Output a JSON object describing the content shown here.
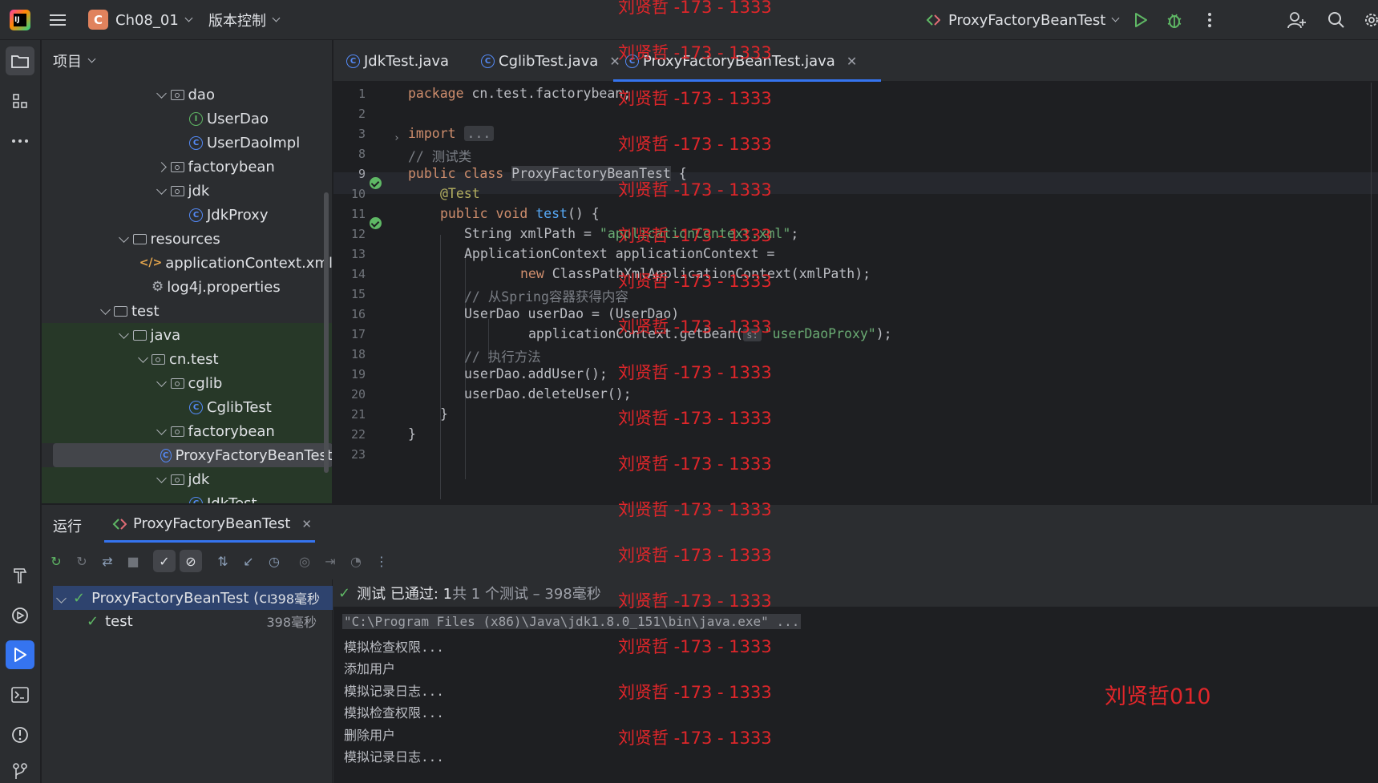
{
  "topbar": {
    "project_badge": "C",
    "project_name": "Ch08_01",
    "vcs_label": "版本控制",
    "run_config": "ProxyFactoryBeanTest"
  },
  "project_panel": {
    "header": "项目",
    "tree": [
      {
        "label": "dao",
        "kind": "package",
        "indent": 3,
        "chev": "open"
      },
      {
        "label": "UserDao",
        "kind": "interface",
        "indent": 4
      },
      {
        "label": "UserDaoImpl",
        "kind": "class",
        "indent": 4
      },
      {
        "label": "factorybean",
        "kind": "package",
        "indent": 3,
        "chev": "closed"
      },
      {
        "label": "jdk",
        "kind": "package",
        "indent": 3,
        "chev": "open"
      },
      {
        "label": "JdkProxy",
        "kind": "class",
        "indent": 4
      },
      {
        "label": "resources",
        "kind": "resfolder",
        "indent": 1,
        "chev": "open"
      },
      {
        "label": "applicationContext.xml",
        "kind": "xml",
        "indent": 2
      },
      {
        "label": "log4j.properties",
        "kind": "props",
        "indent": 2
      },
      {
        "label": "test",
        "kind": "folder",
        "indent": 0,
        "chev": "open"
      },
      {
        "label": "java",
        "kind": "srcfolder",
        "indent": 1,
        "chev": "open",
        "testbg": true
      },
      {
        "label": "cn.test",
        "kind": "package",
        "indent": 2,
        "chev": "open",
        "testbg": true
      },
      {
        "label": "cglib",
        "kind": "package",
        "indent": 3,
        "chev": "open",
        "testbg": true
      },
      {
        "label": "CglibTest",
        "kind": "class",
        "indent": 4,
        "testbg": true
      },
      {
        "label": "factorybean",
        "kind": "package",
        "indent": 3,
        "chev": "open",
        "testbg": true
      },
      {
        "label": "ProxyFactoryBeanTest",
        "kind": "class",
        "indent": 4,
        "selected": true
      },
      {
        "label": "jdk",
        "kind": "package",
        "indent": 3,
        "chev": "open",
        "testbg": true
      },
      {
        "label": "JdkTest",
        "kind": "class",
        "indent": 4,
        "testbg": true
      }
    ]
  },
  "tabs": [
    {
      "label": "JdkTest.java",
      "closable": false
    },
    {
      "label": "CglibTest.java",
      "closable": true
    },
    {
      "label": "ProxyFactoryBeanTest.java",
      "closable": true,
      "active": true
    }
  ],
  "editor": {
    "line_numbers": [
      "1",
      "2",
      "3",
      "8",
      "9",
      "10",
      "11",
      "12",
      "13",
      "14",
      "15",
      "16",
      "17",
      "18",
      "19",
      "20",
      "21",
      "22",
      "23"
    ],
    "lines": {
      "l1_kw": "package",
      "l1_rest": " cn.test.factorybean;",
      "l3_kw": "import",
      "l3_fold": "...",
      "l8": "// 测试类",
      "l9_kw": "public class ",
      "l9_cls": "ProxyFactoryBeanTest",
      "l9_rest": " {",
      "l10": "@Test",
      "l11_kw": "public void ",
      "l11_fn": "test",
      "l11_rest": "() {",
      "l12_a": "String xmlPath = ",
      "l12_str": "\"applicationContext.xml\"",
      "l12_b": ";",
      "l13": "ApplicationContext applicationContext =",
      "l14_kw": "new ",
      "l14_rest": "ClassPathXmlApplicationContext(xmlPath);",
      "l15": "// 从Spring容器获得内容",
      "l16": "UserDao userDao = (UserDao)",
      "l17_a": "applicationContext.getBean(",
      "l17_hint": "s:",
      "l17_str": "\"userDaoProxy\"",
      "l17_b": ");",
      "l18": "// 执行方法",
      "l19": "userDao.addUser();",
      "l20": "userDao.deleteUser();",
      "l21": "}",
      "l22": "}"
    }
  },
  "run_panel": {
    "label": "运行",
    "tab": "ProxyFactoryBeanTest",
    "tree": [
      {
        "label": "ProxyFactoryBeanTest (cı",
        "duration": "398毫秒"
      },
      {
        "label": "test",
        "duration": "398毫秒"
      }
    ],
    "status_passed": "测试 已通过: 1",
    "status_detail": "共 1 个测试 – 398毫秒",
    "console": [
      "\"C:\\Program Files (x86)\\Java\\jdk1.8.0_151\\bin\\java.exe\" ...",
      "模拟检查权限...",
      "添加用户",
      "模拟记录日志...",
      "模拟检查权限...",
      "删除用户",
      "模拟记录日志..."
    ]
  },
  "watermarks": {
    "repeat": "刘贤哲 -173 - 1333",
    "corner": "刘贤哲010"
  },
  "colors": {
    "accent": "#3574f0",
    "pass": "#5fb865",
    "watermark": "#e0262a"
  }
}
